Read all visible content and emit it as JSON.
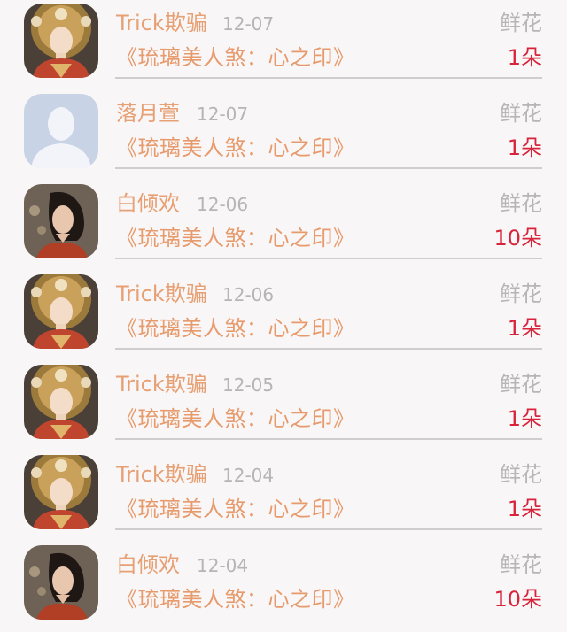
{
  "items": [
    {
      "name": "Trick欺骗",
      "date": "12-07",
      "gift": "鲜花",
      "book": "《琉璃美人煞：心之印》",
      "count": "1朵",
      "avatar": "costume-woman-gold-headdress"
    },
    {
      "name": "落月萱",
      "date": "12-07",
      "gift": "鲜花",
      "book": "《琉璃美人煞：心之印》",
      "count": "1朵",
      "avatar": "default-user-silhouette"
    },
    {
      "name": "白倾欢",
      "date": "12-06",
      "gift": "鲜花",
      "book": "《琉璃美人煞：心之印》",
      "count": "10朵",
      "avatar": "dark-haired-woman-portrait"
    },
    {
      "name": "Trick欺骗",
      "date": "12-06",
      "gift": "鲜花",
      "book": "《琉璃美人煞：心之印》",
      "count": "1朵",
      "avatar": "costume-woman-gold-headdress"
    },
    {
      "name": "Trick欺骗",
      "date": "12-05",
      "gift": "鲜花",
      "book": "《琉璃美人煞：心之印》",
      "count": "1朵",
      "avatar": "costume-woman-gold-headdress"
    },
    {
      "name": "Trick欺骗",
      "date": "12-04",
      "gift": "鲜花",
      "book": "《琉璃美人煞：心之印》",
      "count": "1朵",
      "avatar": "costume-woman-gold-headdress"
    },
    {
      "name": "白倾欢",
      "date": "12-04",
      "gift": "鲜花",
      "book": "《琉璃美人煞：心之印》",
      "count": "10朵",
      "avatar": "dark-haired-woman-portrait"
    }
  ],
  "colors": {
    "name": "#e7a074",
    "date": "#b8b3b4",
    "gift": "#b9b5b6",
    "book": "#e79a6b",
    "count": "#d7243b",
    "divider": "#cfcdce",
    "background": "#f8f6f7"
  }
}
